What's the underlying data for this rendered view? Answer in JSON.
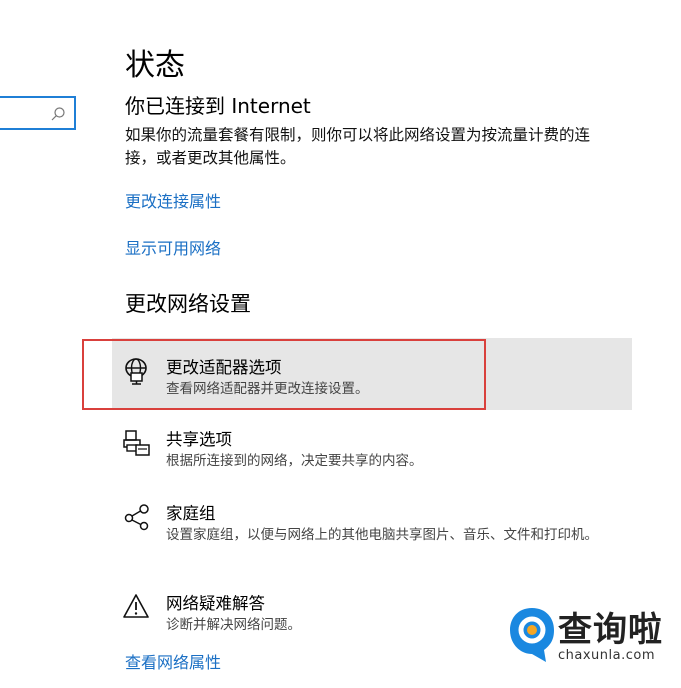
{
  "search": {
    "icon": "search-icon",
    "accent_color": "#1f7fd6"
  },
  "page_title": "状态",
  "status": {
    "heading": "你已连接到 Internet",
    "description": "如果你的流量套餐有限制，则你可以将此网络设置为按流量计费的连接，或者更改其他属性。"
  },
  "links": {
    "change_connection_properties": "更改连接属性",
    "show_available_networks": "显示可用网络",
    "view_network_properties": "查看网络属性",
    "color": "#1a6fc4"
  },
  "change_network_settings": {
    "heading": "更改网络设置",
    "options": [
      {
        "icon": "adapter-globe-icon",
        "title": "更改适配器选项",
        "description": "查看网络适配器并更改连接设置。",
        "highlighted": true
      },
      {
        "icon": "sharing-printer-icon",
        "title": "共享选项",
        "description": "根据所连接到的网络，决定要共享的内容。"
      },
      {
        "icon": "homegroup-icon",
        "title": "家庭组",
        "description": "设置家庭组，以便与网络上的其他电脑共享图片、音乐、文件和打印机。"
      },
      {
        "icon": "warning-triangle-icon",
        "title": "网络疑难解答",
        "description": "诊断并解决网络问题。"
      }
    ]
  },
  "highlight_frame_color": "#d9403c",
  "watermark": {
    "text": "查询啦",
    "domain": "chaxunla.com",
    "icon": "watermark-logo-icon"
  }
}
